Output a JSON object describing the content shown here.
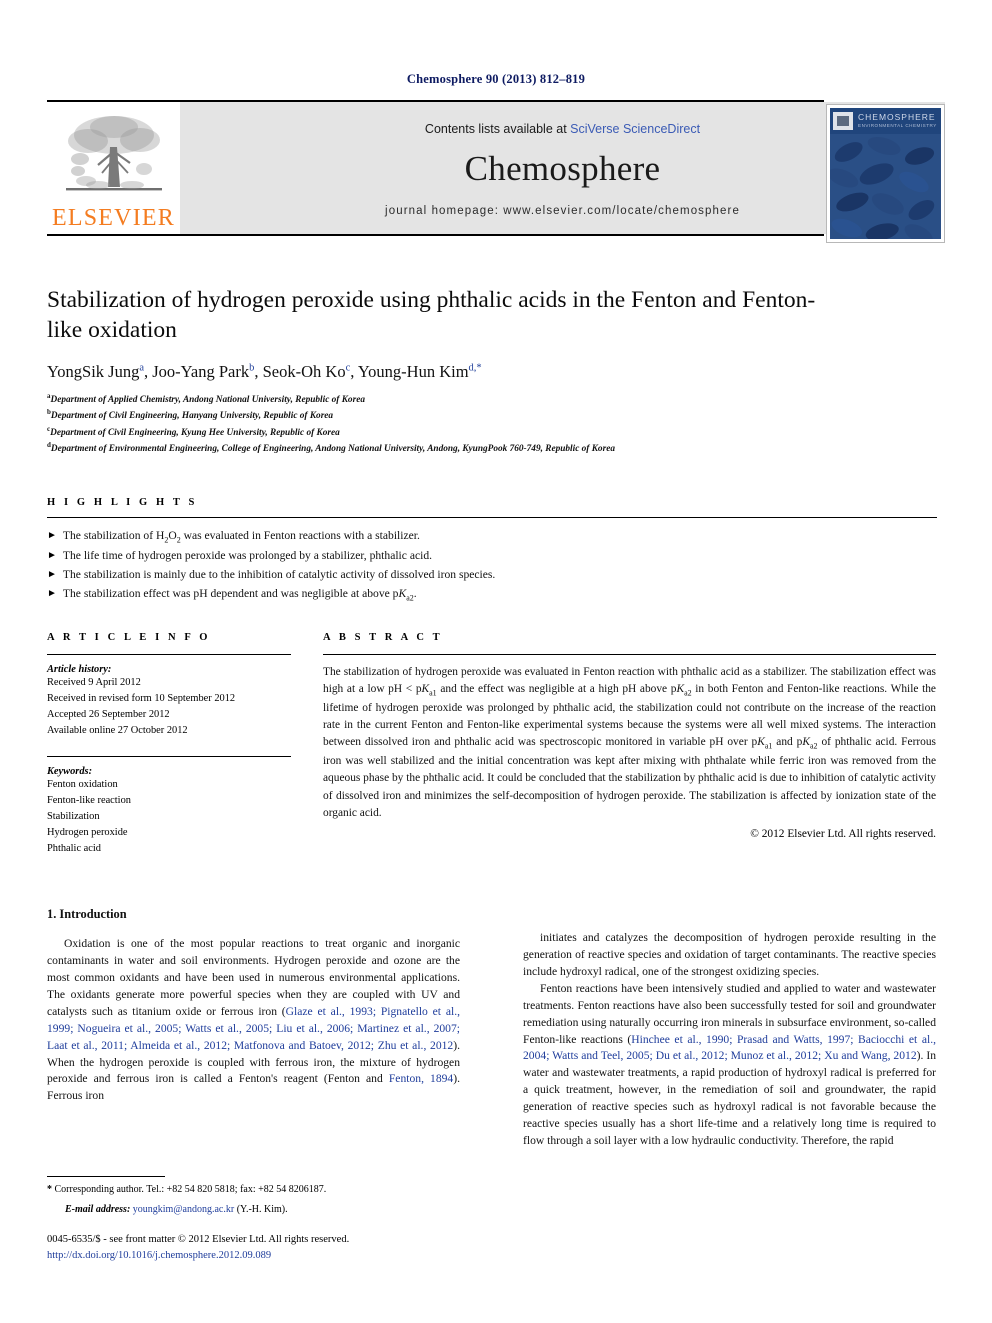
{
  "running_head": "Chemosphere 90 (2013) 812–819",
  "masthead": {
    "publisher": "ELSEVIER",
    "contents_prefix": "Contents lists available at ",
    "contents_link": "SciVerse ScienceDirect",
    "journal_name": "Chemosphere",
    "homepage": "journal homepage: www.elsevier.com/locate/chemosphere",
    "cover_title": "CHEMOSPHERE",
    "cover_subtitle": "ENVIRONMENTAL CHEMISTRY"
  },
  "article": {
    "title": "Stabilization of hydrogen peroxide using phthalic acids in the Fenton and Fenton-like oxidation",
    "authors": [
      {
        "name": "YongSik Jung",
        "sup": "a"
      },
      {
        "name": "Joo-Yang Park",
        "sup": "b"
      },
      {
        "name": "Seok-Oh Ko",
        "sup": "c"
      },
      {
        "name": "Young-Hun Kim",
        "sup": "d,*"
      }
    ],
    "affiliations": [
      {
        "sup": "a",
        "text": "Department of Applied Chemistry, Andong National University, Republic of Korea"
      },
      {
        "sup": "b",
        "text": "Department of Civil Engineering, Hanyang University, Republic of Korea"
      },
      {
        "sup": "c",
        "text": "Department of Civil Engineering, Kyung Hee University, Republic of Korea"
      },
      {
        "sup": "d",
        "text": "Department of Environmental Engineering, College of Engineering, Andong National University, Andong, KyungPook 760-749, Republic of Korea"
      }
    ]
  },
  "highlights": {
    "heading": "H I G H L I G H T S",
    "items": [
      "The stabilization of H<sub>2</sub>O<sub>2</sub> was evaluated in Fenton reactions with a stabilizer.",
      "The life time of hydrogen peroxide was prolonged by a stabilizer, phthalic acid.",
      "The stabilization is mainly due to the inhibition of catalytic activity of dissolved iron species.",
      "The stabilization effect was pH dependent and was negligible at above p<i>K</i><sub>a2</sub>."
    ]
  },
  "article_info": {
    "heading": "A R T I C L E  I N F O",
    "history_label": "Article history:",
    "history": [
      "Received 9 April 2012",
      "Received in revised form 10 September 2012",
      "Accepted 26 September 2012",
      "Available online 27 October 2012"
    ],
    "keywords_label": "Keywords:",
    "keywords": [
      "Fenton oxidation",
      "Fenton-like reaction",
      "Stabilization",
      "Hydrogen peroxide",
      "Phthalic acid"
    ]
  },
  "abstract": {
    "heading": "A B S T R A C T",
    "text": "The stabilization of hydrogen peroxide was evaluated in Fenton reaction with phthalic acid as a stabilizer. The stabilization effect was high at a low pH < p<i>K</i><sub>a1</sub> and the effect was negligible at a high pH above p<i>K</i><sub>a2</sub> in both Fenton and Fenton-like reactions. While the lifetime of hydrogen peroxide was prolonged by phthalic acid, the stabilization could not contribute on the increase of the reaction rate in the current Fenton and Fenton-like experimental systems because the systems were all well mixed systems. The interaction between dissolved iron and phthalic acid was spectroscopic monitored in variable pH over p<i>K</i><sub>a1</sub> and p<i>K</i><sub>a2</sub> of phthalic acid. Ferrous iron was well stabilized and the initial concentration was kept after mixing with phthalate while ferric iron was removed from the aqueous phase by the phthalic acid. It could be concluded that the stabilization by phthalic acid is due to inhibition of catalytic activity of dissolved iron and minimizes the self-decomposition of hydrogen peroxide. The stabilization is affected by ionization state of the organic acid.",
    "copyright": "© 2012 Elsevier Ltd. All rights reserved."
  },
  "body": {
    "section_heading": "1. Introduction",
    "left_paragraphs": [
      "Oxidation is one of the most popular reactions to treat organic and inorganic contaminants in water and soil environments. Hydrogen peroxide and ozone are the most common oxidants and have been used in numerous environmental applications. The oxidants generate more powerful species when they are coupled with UV and catalysts such as titanium oxide or ferrous iron (<span class=\"cite\">Glaze et al., 1993; Pignatello et al., 1999; Nogueira et al., 2005; Watts et al., 2005; Liu et al., 2006; Martinez et al., 2007; Laat et al., 2011; Almeida et al., 2012; Matfonova and Batoev, 2012; Zhu et al., 2012</span>). When the hydrogen peroxide is coupled with ferrous iron, the mixture of hydrogen peroxide and ferrous iron is called a Fenton's reagent (Fenton and <span class=\"cite\">Fenton, 1894</span>). Ferrous iron"
    ],
    "right_paragraphs": [
      "initiates and catalyzes the decomposition of hydrogen peroxide resulting in the generation of reactive species and oxidation of target contaminants. The reactive species include hydroxyl radical, one of the strongest oxidizing species.",
      "Fenton reactions have been intensively studied and applied to water and wastewater treatments. Fenton reactions have also been successfully tested for soil and groundwater remediation using naturally occurring iron minerals in subsurface environment, so-called Fenton-like reactions (<span class=\"cite\">Hinchee et al., 1990; Prasad and Watts, 1997; Baciocchi et al., 2004; Watts and Teel, 2005; Du et al., 2012; Munoz et al., 2012; Xu and Wang, 2012</span>). In water and wastewater treatments, a rapid production of hydroxyl radical is preferred for a quick treatment, however, in the remediation of soil and groundwater, the rapid generation of reactive species such as hydroxyl radical is not favorable because the reactive species usually has a short life-time and a relatively long time is required to flow through a soil layer with a low hydraulic conductivity. Therefore, the rapid"
    ]
  },
  "footer": {
    "corresponding": "Corresponding author. Tel.: +82 54 820 5818; fax: +82 54 8206187.",
    "email_label": "E-mail address:",
    "email": "youngkim@andong.ac.kr",
    "email_suffix": "(Y.-H. Kim).",
    "imprint": "0045-6535/$ - see front matter © 2012 Elsevier Ltd. All rights reserved.",
    "doi": "http://dx.doi.org/10.1016/j.chemosphere.2012.09.089"
  }
}
